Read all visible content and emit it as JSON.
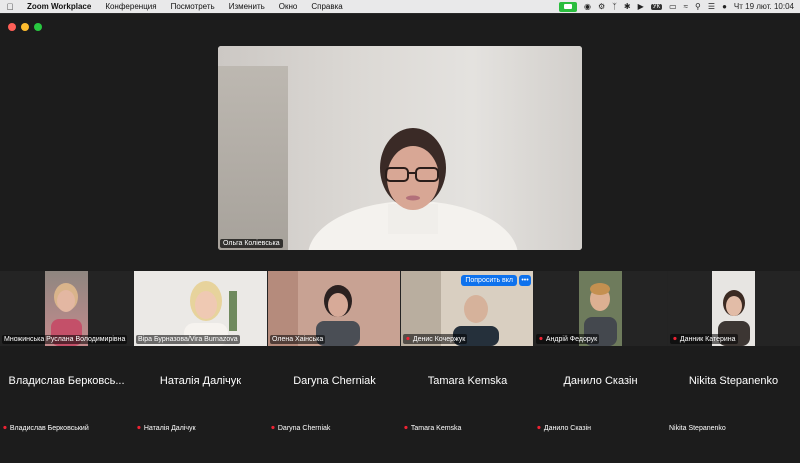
{
  "menubar": {
    "app": "Zoom Workplace",
    "items": [
      "Конференция",
      "Посмотреть",
      "Изменить",
      "Окно",
      "Справка"
    ],
    "keyboard_layout": "УК",
    "datetime": "Чт 19 лют. 10:04"
  },
  "speaker": {
    "name": "Ольга Коліевська"
  },
  "gallery": [
    {
      "name": "Множинська Руслана Володимирівна",
      "muted": false
    },
    {
      "name": "Віра Бурназова/Vira Burnazova",
      "muted": false
    },
    {
      "name": "Олена Хаінська",
      "muted": false
    },
    {
      "name": "Денис Кочержук",
      "muted": true,
      "ask_label": "Попросить вкл",
      "more_label": "•••"
    },
    {
      "name": "Андрій Федорук",
      "muted": true
    },
    {
      "name": "Данник Катерина",
      "muted": true
    }
  ],
  "name_tiles": [
    {
      "display": "Владислав Берковсь...",
      "label": "Владислав Берковський",
      "muted": true
    },
    {
      "display": "Наталія Далічук",
      "label": "Наталія Далічук",
      "muted": true
    },
    {
      "display": "Daryna Cherniak",
      "label": "Daryna Cherniak",
      "muted": true
    },
    {
      "display": "Tamara Kemska",
      "label": "Tamara Kemska",
      "muted": true
    },
    {
      "display": "Данило Сказін",
      "label": "Данило Сказін",
      "muted": true
    },
    {
      "display": "Nikita Stepanenko",
      "label": "Nikita Stepanenko",
      "muted": false
    }
  ],
  "icons": [
    "apple-icon",
    "zoom-camera-icon",
    "bluetooth-icon",
    "wifi-icon",
    "battery-icon",
    "mic-muted-icon"
  ]
}
